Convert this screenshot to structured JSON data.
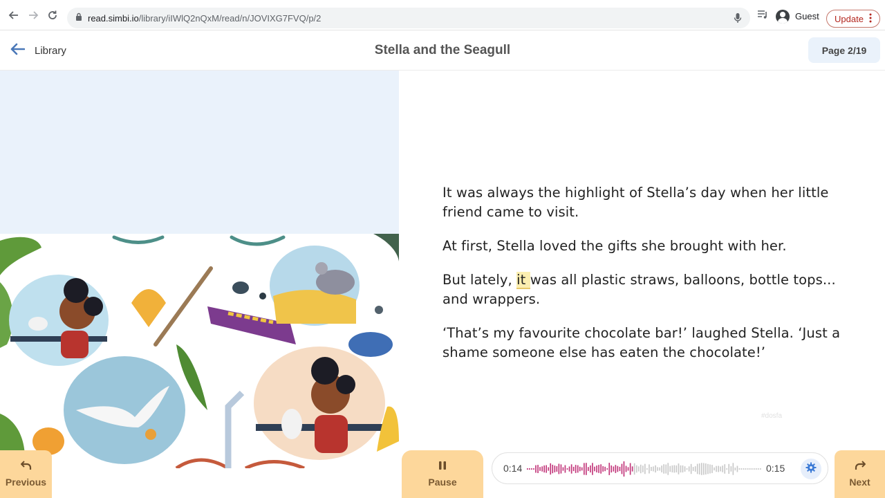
{
  "browser": {
    "url_host": "read.simbi.io",
    "url_path": "/library/iIWlQ2nQxM/read/n/JOVIXG7FVQ/p/2",
    "profile_label": "Guest",
    "update_label": "Update"
  },
  "header": {
    "back_label": "Library",
    "title": "Stella and the Seagull",
    "page_label": "Page 2/19"
  },
  "story": {
    "p1": "It was always the highlight of Stella’s day when her little friend came to visit.",
    "p2": "At first, Stella loved the gifts she brought with her.",
    "p3_before": "But lately, ",
    "p3_highlight": "it ",
    "p3_after": "was all plastic straws, balloons, bottle tops... and wrappers.",
    "p4": "‘That’s my favourite chocolate bar!’ laughed Stella. ‘Just a shame someone else has eaten the chocolate!’",
    "watermark": "#dosfa"
  },
  "controls": {
    "previous_label": "Previous",
    "pause_label": "Pause",
    "next_label": "Next",
    "time_current": "0:14",
    "time_total": "0:15",
    "played_fraction": 0.45
  },
  "colors": {
    "panel_bg": "#eaf2fb",
    "button_bg": "#fdd79b",
    "highlight": "#fbeeb0",
    "wave_played": "#c2367a",
    "wave_remaining": "#c9c9c9"
  }
}
